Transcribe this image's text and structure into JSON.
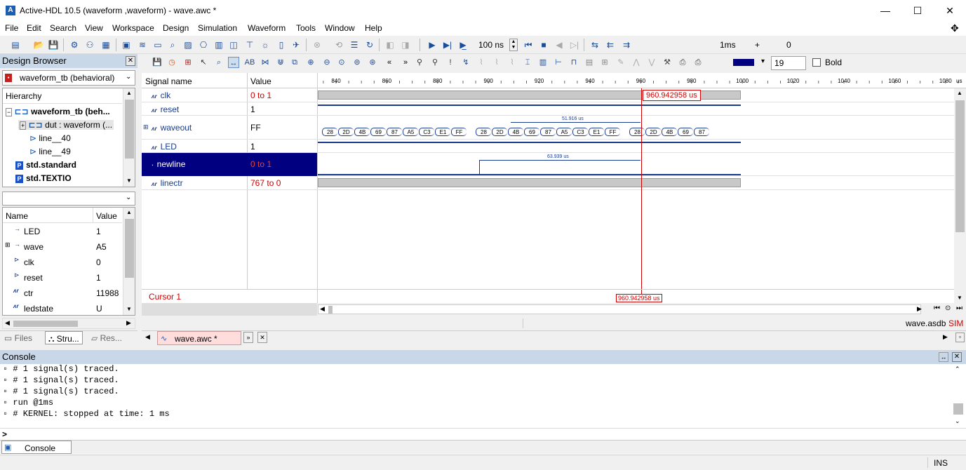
{
  "window": {
    "title": "Active-HDL 10.5 (waveform ,waveform) - wave.awc *",
    "app_icon": "A",
    "minimize": "—",
    "maximize": "☐",
    "close": "✕"
  },
  "menu": [
    "File",
    "Edit",
    "Search",
    "View",
    "Workspace",
    "Design",
    "Simulation",
    "Waveform",
    "Tools",
    "Window",
    "Help"
  ],
  "toolbar": {
    "sim_step": "100 ns",
    "run_time": "1ms",
    "plus": "+",
    "offset": "0"
  },
  "design_browser": {
    "title": "Design Browser",
    "design_select": "waveform_tb (behavioral)",
    "hierarchy_header": "Hierarchy",
    "tree": [
      {
        "label": "waveform_tb (beh...",
        "bold": true
      },
      {
        "label": "dut : waveform (...",
        "bold": false
      },
      {
        "label": "line__40",
        "bold": false
      },
      {
        "label": "line__49",
        "bold": false
      },
      {
        "label": "std.standard",
        "bold": true
      },
      {
        "label": "std.TEXTIO",
        "bold": true
      }
    ],
    "filter_value": "",
    "columns": {
      "name": "Name",
      "value": "Value"
    },
    "signals": [
      {
        "name": "LED",
        "value": "1"
      },
      {
        "name": "wave",
        "value": "A5"
      },
      {
        "name": "clk",
        "value": "0"
      },
      {
        "name": "reset",
        "value": "1"
      },
      {
        "name": "ctr",
        "value": "11988"
      },
      {
        "name": "ledstate",
        "value": "U"
      }
    ],
    "tabs": [
      "Files",
      "Stru...",
      "Res..."
    ]
  },
  "waveform": {
    "color_field": "",
    "font_size": "19",
    "bold_label": "Bold",
    "header_signal": "Signal name",
    "header_value": "Value",
    "ticks": [
      "840",
      "860",
      "880",
      "900",
      "920",
      "940",
      "960",
      "980",
      "1000",
      "1020",
      "1040",
      "1060",
      "1080"
    ],
    "tick_unit": "us",
    "signals": [
      {
        "name": "clk",
        "value": "0 to 1"
      },
      {
        "name": "reset",
        "value": "1"
      },
      {
        "name": "waveout",
        "value": "FF"
      },
      {
        "name": "LED",
        "value": "1"
      },
      {
        "name": "newline",
        "value": "0 to 1"
      },
      {
        "name": "linectr",
        "value": "767 to 0"
      }
    ],
    "hex_values": [
      "28",
      "2D",
      "4B",
      "69",
      "87",
      "A5",
      "C3",
      "E1",
      "FF",
      "28",
      "2D",
      "4B",
      "69",
      "87",
      "A5",
      "C3",
      "E1",
      "FF",
      "28",
      "2D",
      "4B",
      "69",
      "87"
    ],
    "measure1": "51.916 us",
    "measure2": "63.939 us",
    "cursor_label": "Cursor 1",
    "cursor_time": "960.942958 us",
    "tab_label": "wave.awc *",
    "status_file": "wave.asdb",
    "status_mode": "SIM"
  },
  "console": {
    "title": "Console",
    "lines": [
      "# 1 signal(s) traced.",
      "# 1 signal(s) traced.",
      "# 1 signal(s) traced.",
      "run @1ms",
      "# KERNEL: stopped at time: 1 ms"
    ],
    "prompt": ">",
    "tab": "Console"
  },
  "status": {
    "ins": "INS"
  }
}
